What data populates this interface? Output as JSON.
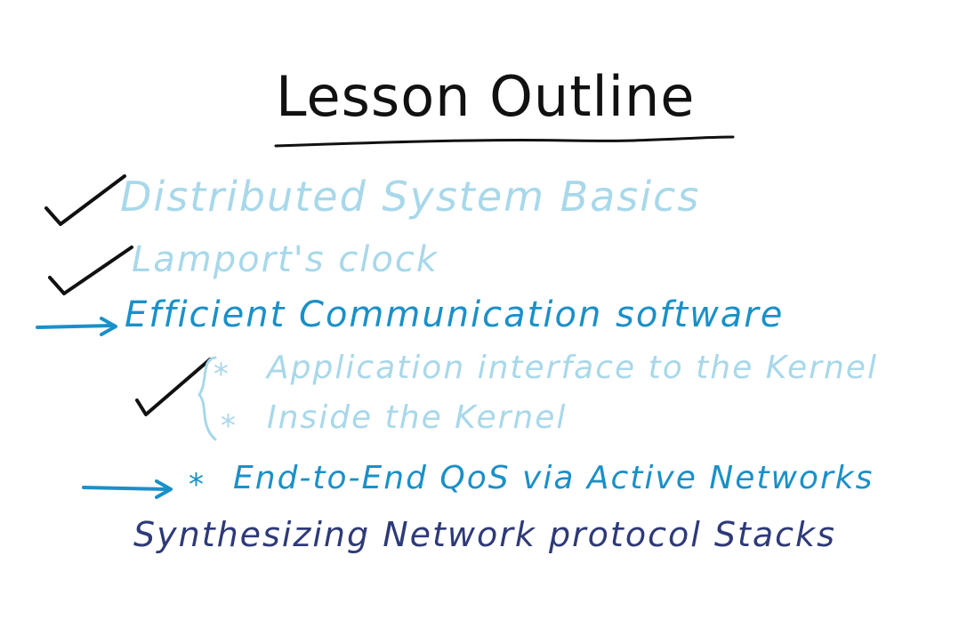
{
  "title": "Lesson Outline",
  "items": [
    {
      "text": "Distributed System Basics",
      "status": "done"
    },
    {
      "text": "Lamport's clock",
      "status": "done"
    },
    {
      "text": "Efficient Communication software",
      "status": "current"
    },
    {
      "text": "Synthesizing Network protocol Stacks",
      "status": "upcoming"
    }
  ],
  "subitems": [
    {
      "text": "Application interface to the Kernel",
      "status": "done"
    },
    {
      "text": "Inside the Kernel",
      "status": "done"
    },
    {
      "text": "End-to-End QoS via Active Networks",
      "status": "current"
    }
  ],
  "marks": {
    "bullet_star": "*"
  },
  "colors": {
    "title": "#111111",
    "done": "#a8d8ea",
    "current": "#1a90c8",
    "upcoming": "#2e3a78",
    "check": "#111111"
  },
  "icons": {
    "done": "check-mark-icon",
    "current": "arrow-right-icon"
  }
}
